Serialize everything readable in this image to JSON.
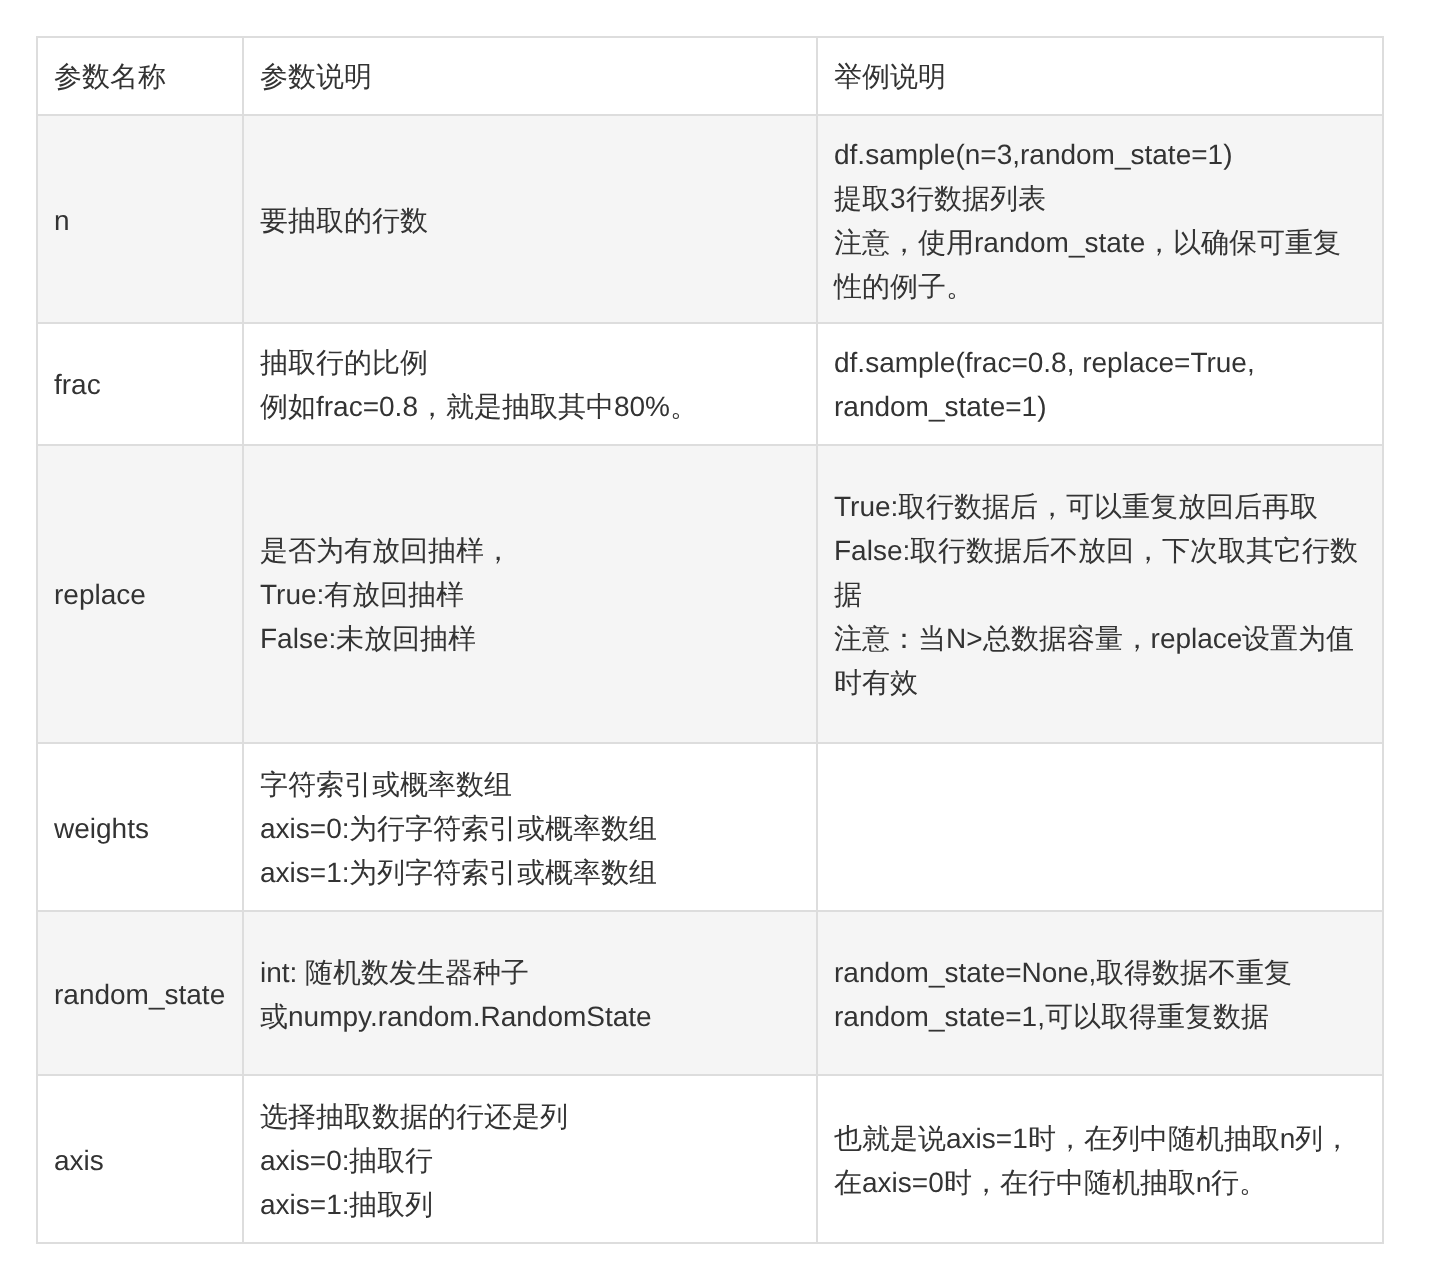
{
  "table": {
    "columns": [
      "参数名称",
      "参数说明",
      "举例说明"
    ],
    "rows": [
      {
        "cells": [
          [
            "n"
          ],
          [
            "要抽取的行数"
          ],
          [
            "df.sample(n=3,random_state=1)",
            "提取3行数据列表",
            "注意，使用random_state，以确保可重复性的例子。"
          ]
        ]
      },
      {
        "cells": [
          [
            "frac"
          ],
          [
            "抽取行的比例",
            "例如frac=0.8，就是抽取其中80%。"
          ],
          [
            "df.sample(frac=0.8, replace=True, random_state=1)"
          ]
        ]
      },
      {
        "cells": [
          [
            "replace"
          ],
          [
            "是否为有放回抽样，",
            "True:有放回抽样",
            "False:未放回抽样"
          ],
          [
            "True:取行数据后，可以重复放回后再取",
            "False:取行数据后不放回，下次取其它行数据",
            "注意：当N>总数据容量，replace设置为值时有效"
          ]
        ]
      },
      {
        "cells": [
          [
            "weights"
          ],
          [
            "字符索引或概率数组",
            "axis=0:为行字符索引或概率数组",
            "axis=1:为列字符索引或概率数组"
          ],
          []
        ]
      },
      {
        "cells": [
          [
            "random_state"
          ],
          [
            "int: 随机数发生器种子",
            "或numpy.random.RandomState"
          ],
          [
            "random_state=None,取得数据不重复",
            "random_state=1,可以取得重复数据"
          ]
        ]
      },
      {
        "cells": [
          [
            "axis"
          ],
          [
            "选择抽取数据的行还是列",
            "axis=0:抽取行",
            "axis=1:抽取列"
          ],
          [
            "也就是说axis=1时，在列中随机抽取n列，在axis=0时，在行中随机抽取n行。"
          ]
        ]
      }
    ]
  }
}
